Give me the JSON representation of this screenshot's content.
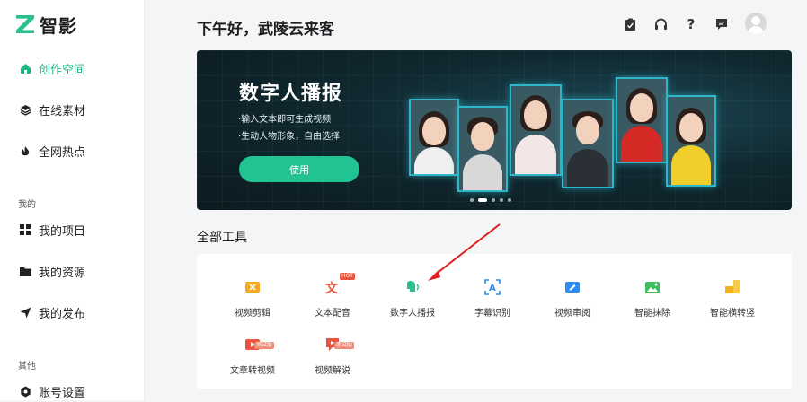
{
  "brand": {
    "name": "智影",
    "color": "#2ac089"
  },
  "sidebar": {
    "items": [
      {
        "label": "创作空间",
        "icon": "home-icon",
        "active": true
      },
      {
        "label": "在线素材",
        "icon": "layers-icon"
      },
      {
        "label": "全网热点",
        "icon": "flame-icon"
      }
    ],
    "section_mine": "我的",
    "mine_items": [
      {
        "label": "我的项目",
        "icon": "grid-icon"
      },
      {
        "label": "我的资源",
        "icon": "folder-icon"
      },
      {
        "label": "我的发布",
        "icon": "send-icon"
      }
    ],
    "section_other": "其他",
    "other_items": [
      {
        "label": "账号设置",
        "icon": "settings-icon"
      }
    ]
  },
  "header": {
    "greeting": "下午好，武陵云来客",
    "icons": [
      "clipboard-icon",
      "headset-icon",
      "help-icon",
      "message-icon",
      "avatar"
    ]
  },
  "banner": {
    "title": "数字人播报",
    "lines": [
      "·输入文本即可生成视频",
      "·生动人物形象，自由选择"
    ],
    "button": "使用",
    "slides": 5,
    "active_slide": 2
  },
  "tools": {
    "title": "全部工具",
    "items": [
      {
        "label": "视频剪辑",
        "icon": "video-cut-icon",
        "color": "#f5a623"
      },
      {
        "label": "文本配音",
        "icon": "text-voice-icon",
        "color": "#e8553e",
        "badge": "HOT"
      },
      {
        "label": "数字人播报",
        "icon": "digital-human-icon",
        "color": "#2ac089"
      },
      {
        "label": "字幕识别",
        "icon": "subtitle-recognize-icon",
        "color": "#2d8cf0"
      },
      {
        "label": "视频审阅",
        "icon": "video-review-icon",
        "color": "#2d8cf0"
      },
      {
        "label": "智能抹除",
        "icon": "smart-erase-icon",
        "color": "#3dbf5f"
      },
      {
        "label": "智能横转竖",
        "icon": "landscape-to-portrait-icon",
        "color": "#f5b21d"
      },
      {
        "label": "文章转视频",
        "icon": "article-to-video-icon",
        "color": "#e8553e",
        "badge": "测试版"
      },
      {
        "label": "视频解说",
        "icon": "video-narration-icon",
        "color": "#e8553e",
        "badge": "测试版"
      }
    ]
  },
  "annotation": {
    "arrow_color": "#e02020"
  }
}
